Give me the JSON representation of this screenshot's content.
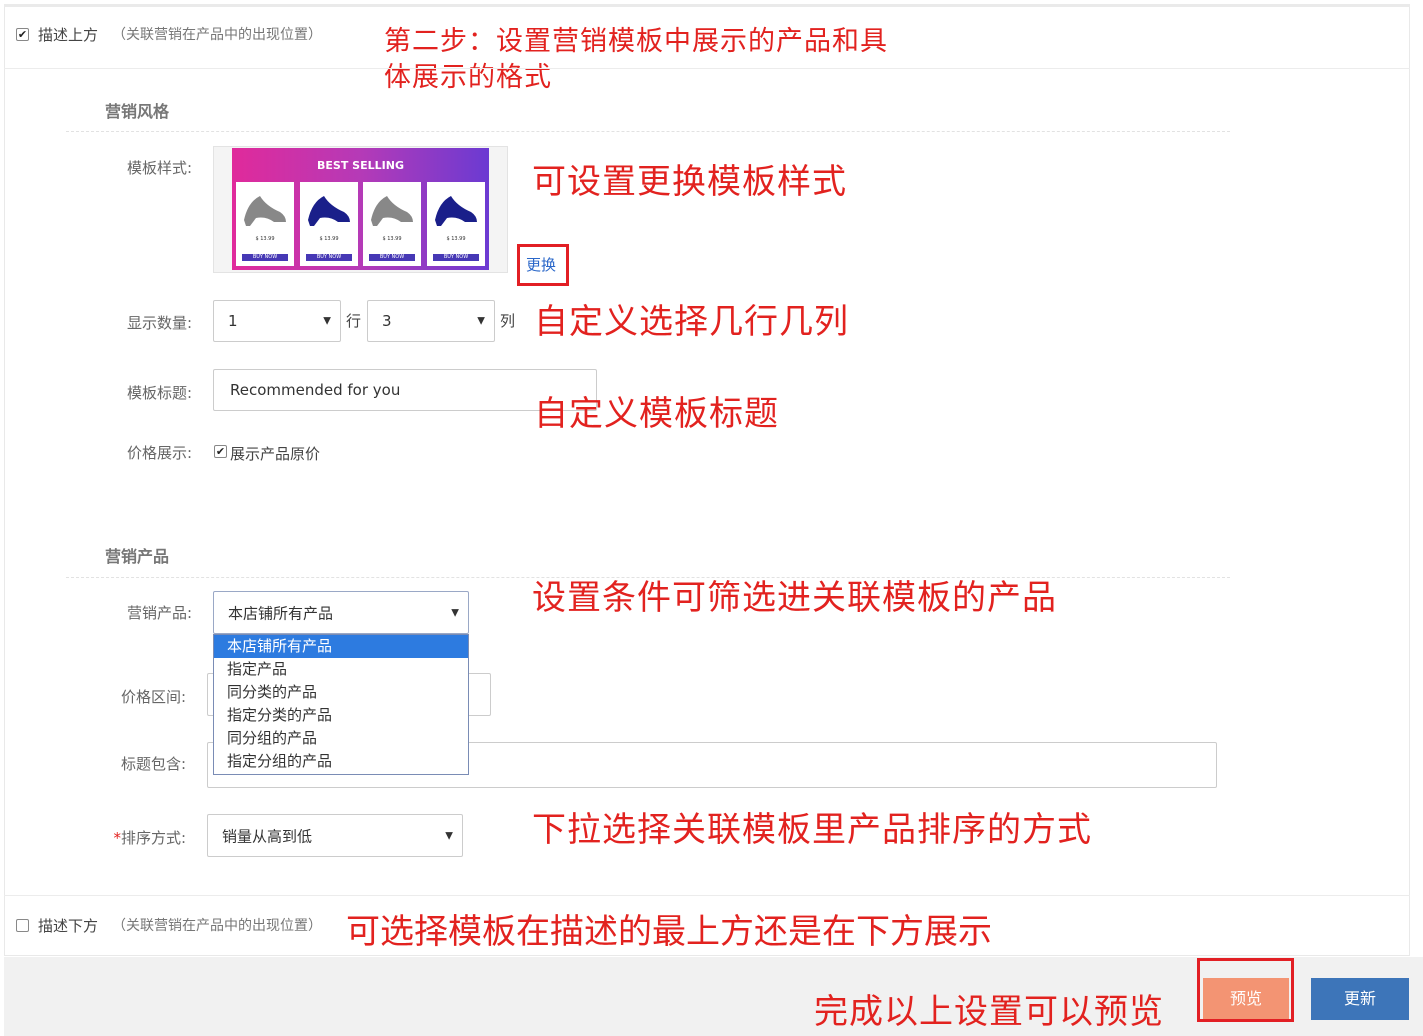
{
  "top_option": {
    "label": "描述上方",
    "hint": "（关联营销在产品中的出现位置）",
    "checked": true
  },
  "bottom_option": {
    "label": "描述下方",
    "hint": "（关联营销在产品中的出现位置）",
    "checked": false
  },
  "sections": {
    "style": "营销风格",
    "products": "营销产品"
  },
  "form": {
    "template_style_label": "模板样式:",
    "change_link": "更换",
    "display_count_label": "显示数量:",
    "rows_value": "1",
    "rows_unit": "行",
    "cols_value": "3",
    "cols_unit": "列",
    "template_title_label": "模板标题:",
    "template_title_value": "Recommended for you",
    "price_display_label": "价格展示:",
    "show_original_price": "展示产品原价",
    "marketing_product_label": "营销产品:",
    "marketing_product_value": "本店铺所有产品",
    "price_range_label": "价格区间:",
    "title_contains_label": "标题包含:",
    "sort_required_mark": "*",
    "sort_label": "排序方式:",
    "sort_value": "销量从高到低"
  },
  "dropdown_options": [
    "本店铺所有产品",
    "指定产品",
    "同分类的产品",
    "指定分类的产品",
    "同分组的产品",
    "指定分组的产品"
  ],
  "dropdown_selected_index": 0,
  "thumbnail": {
    "banner": "BEST SELLING",
    "price": "$ 13.99",
    "buy": "BUY NOW"
  },
  "buttons": {
    "preview": "预览",
    "update": "更新"
  },
  "notes": {
    "step2_line1": "第二步：设置营销模板中展示的产品和具",
    "step2_line2": "体展示的格式",
    "change_style": "可设置更换模板样式",
    "rows_cols": "自定义选择几行几列",
    "title": "自定义模板标题",
    "filter": "设置条件可筛选进关联模板的产品",
    "sort": "下拉选择关联模板里产品排序的方式",
    "position": "可选择模板在描述的最上方还是在下方展示",
    "preview": "完成以上设置可以预览"
  },
  "colors": {
    "annotation": "#e2221f",
    "preview_btn": "#f39473",
    "update_btn": "#3d75b9",
    "dropdown_selected": "#2d7be0"
  }
}
